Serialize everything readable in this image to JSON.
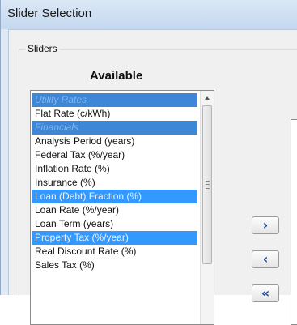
{
  "window": {
    "title": "Slider Selection"
  },
  "group": {
    "label": "Sliders"
  },
  "available": {
    "heading": "Available",
    "items": [
      {
        "label": "Utility Rates",
        "kind": "category"
      },
      {
        "label": "Flat Rate (c/kWh)",
        "kind": "item"
      },
      {
        "label": "Financials",
        "kind": "category"
      },
      {
        "label": "Analysis Period (years)",
        "kind": "item"
      },
      {
        "label": "Federal Tax (%/year)",
        "kind": "item"
      },
      {
        "label": "Inflation Rate (%)",
        "kind": "item"
      },
      {
        "label": "Insurance (%)",
        "kind": "item"
      },
      {
        "label": "Loan (Debt) Fraction (%)",
        "kind": "selected"
      },
      {
        "label": "Loan Rate (%/year)",
        "kind": "item"
      },
      {
        "label": "Loan Term (years)",
        "kind": "item"
      },
      {
        "label": "Property Tax (%/year)",
        "kind": "selected"
      },
      {
        "label": "Real Discount Rate (%)",
        "kind": "item"
      },
      {
        "label": "Sales Tax (%)",
        "kind": "item"
      }
    ]
  },
  "buttons": {
    "add": {
      "glyph": "›",
      "icon": "chevron-right-icon"
    },
    "remove": {
      "glyph": "‹",
      "icon": "chevron-left-icon"
    },
    "remove_all": {
      "glyph": "«",
      "icon": "double-chevron-left-icon"
    }
  },
  "colors": {
    "category_bg": "#3e86d6",
    "selection_bg": "#3399ff",
    "button_glyph": "#1d4e9c"
  }
}
